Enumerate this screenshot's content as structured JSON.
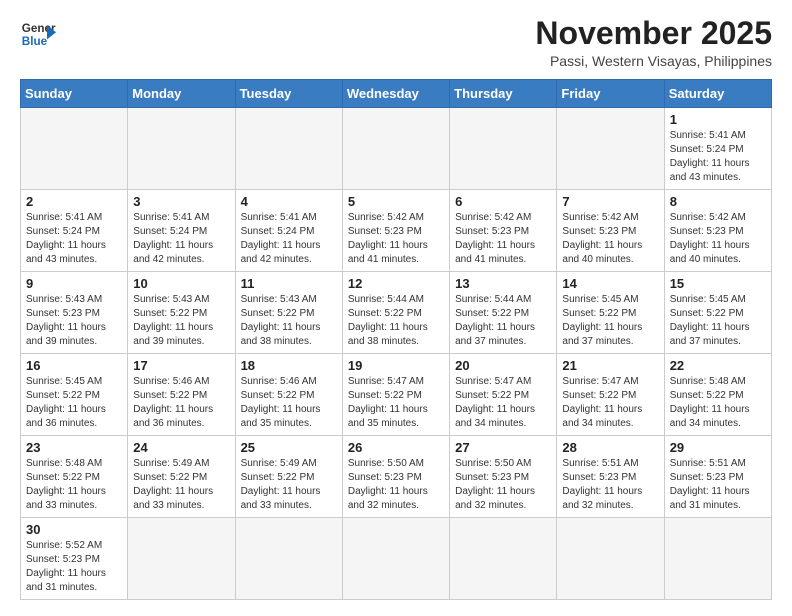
{
  "header": {
    "logo_text_regular": "General",
    "logo_text_blue": "Blue",
    "month_title": "November 2025",
    "location": "Passi, Western Visayas, Philippines"
  },
  "days_of_week": [
    "Sunday",
    "Monday",
    "Tuesday",
    "Wednesday",
    "Thursday",
    "Friday",
    "Saturday"
  ],
  "weeks": [
    [
      {
        "day": "",
        "info": ""
      },
      {
        "day": "",
        "info": ""
      },
      {
        "day": "",
        "info": ""
      },
      {
        "day": "",
        "info": ""
      },
      {
        "day": "",
        "info": ""
      },
      {
        "day": "",
        "info": ""
      },
      {
        "day": "1",
        "info": "Sunrise: 5:41 AM\nSunset: 5:24 PM\nDaylight: 11 hours\nand 43 minutes."
      }
    ],
    [
      {
        "day": "2",
        "info": "Sunrise: 5:41 AM\nSunset: 5:24 PM\nDaylight: 11 hours\nand 43 minutes."
      },
      {
        "day": "3",
        "info": "Sunrise: 5:41 AM\nSunset: 5:24 PM\nDaylight: 11 hours\nand 42 minutes."
      },
      {
        "day": "4",
        "info": "Sunrise: 5:41 AM\nSunset: 5:24 PM\nDaylight: 11 hours\nand 42 minutes."
      },
      {
        "day": "5",
        "info": "Sunrise: 5:42 AM\nSunset: 5:23 PM\nDaylight: 11 hours\nand 41 minutes."
      },
      {
        "day": "6",
        "info": "Sunrise: 5:42 AM\nSunset: 5:23 PM\nDaylight: 11 hours\nand 41 minutes."
      },
      {
        "day": "7",
        "info": "Sunrise: 5:42 AM\nSunset: 5:23 PM\nDaylight: 11 hours\nand 40 minutes."
      },
      {
        "day": "8",
        "info": "Sunrise: 5:42 AM\nSunset: 5:23 PM\nDaylight: 11 hours\nand 40 minutes."
      }
    ],
    [
      {
        "day": "9",
        "info": "Sunrise: 5:43 AM\nSunset: 5:23 PM\nDaylight: 11 hours\nand 39 minutes."
      },
      {
        "day": "10",
        "info": "Sunrise: 5:43 AM\nSunset: 5:22 PM\nDaylight: 11 hours\nand 39 minutes."
      },
      {
        "day": "11",
        "info": "Sunrise: 5:43 AM\nSunset: 5:22 PM\nDaylight: 11 hours\nand 38 minutes."
      },
      {
        "day": "12",
        "info": "Sunrise: 5:44 AM\nSunset: 5:22 PM\nDaylight: 11 hours\nand 38 minutes."
      },
      {
        "day": "13",
        "info": "Sunrise: 5:44 AM\nSunset: 5:22 PM\nDaylight: 11 hours\nand 37 minutes."
      },
      {
        "day": "14",
        "info": "Sunrise: 5:45 AM\nSunset: 5:22 PM\nDaylight: 11 hours\nand 37 minutes."
      },
      {
        "day": "15",
        "info": "Sunrise: 5:45 AM\nSunset: 5:22 PM\nDaylight: 11 hours\nand 37 minutes."
      }
    ],
    [
      {
        "day": "16",
        "info": "Sunrise: 5:45 AM\nSunset: 5:22 PM\nDaylight: 11 hours\nand 36 minutes."
      },
      {
        "day": "17",
        "info": "Sunrise: 5:46 AM\nSunset: 5:22 PM\nDaylight: 11 hours\nand 36 minutes."
      },
      {
        "day": "18",
        "info": "Sunrise: 5:46 AM\nSunset: 5:22 PM\nDaylight: 11 hours\nand 35 minutes."
      },
      {
        "day": "19",
        "info": "Sunrise: 5:47 AM\nSunset: 5:22 PM\nDaylight: 11 hours\nand 35 minutes."
      },
      {
        "day": "20",
        "info": "Sunrise: 5:47 AM\nSunset: 5:22 PM\nDaylight: 11 hours\nand 34 minutes."
      },
      {
        "day": "21",
        "info": "Sunrise: 5:47 AM\nSunset: 5:22 PM\nDaylight: 11 hours\nand 34 minutes."
      },
      {
        "day": "22",
        "info": "Sunrise: 5:48 AM\nSunset: 5:22 PM\nDaylight: 11 hours\nand 34 minutes."
      }
    ],
    [
      {
        "day": "23",
        "info": "Sunrise: 5:48 AM\nSunset: 5:22 PM\nDaylight: 11 hours\nand 33 minutes."
      },
      {
        "day": "24",
        "info": "Sunrise: 5:49 AM\nSunset: 5:22 PM\nDaylight: 11 hours\nand 33 minutes."
      },
      {
        "day": "25",
        "info": "Sunrise: 5:49 AM\nSunset: 5:22 PM\nDaylight: 11 hours\nand 33 minutes."
      },
      {
        "day": "26",
        "info": "Sunrise: 5:50 AM\nSunset: 5:23 PM\nDaylight: 11 hours\nand 32 minutes."
      },
      {
        "day": "27",
        "info": "Sunrise: 5:50 AM\nSunset: 5:23 PM\nDaylight: 11 hours\nand 32 minutes."
      },
      {
        "day": "28",
        "info": "Sunrise: 5:51 AM\nSunset: 5:23 PM\nDaylight: 11 hours\nand 32 minutes."
      },
      {
        "day": "29",
        "info": "Sunrise: 5:51 AM\nSunset: 5:23 PM\nDaylight: 11 hours\nand 31 minutes."
      }
    ],
    [
      {
        "day": "30",
        "info": "Sunrise: 5:52 AM\nSunset: 5:23 PM\nDaylight: 11 hours\nand 31 minutes."
      },
      {
        "day": "",
        "info": ""
      },
      {
        "day": "",
        "info": ""
      },
      {
        "day": "",
        "info": ""
      },
      {
        "day": "",
        "info": ""
      },
      {
        "day": "",
        "info": ""
      },
      {
        "day": "",
        "info": ""
      }
    ]
  ]
}
